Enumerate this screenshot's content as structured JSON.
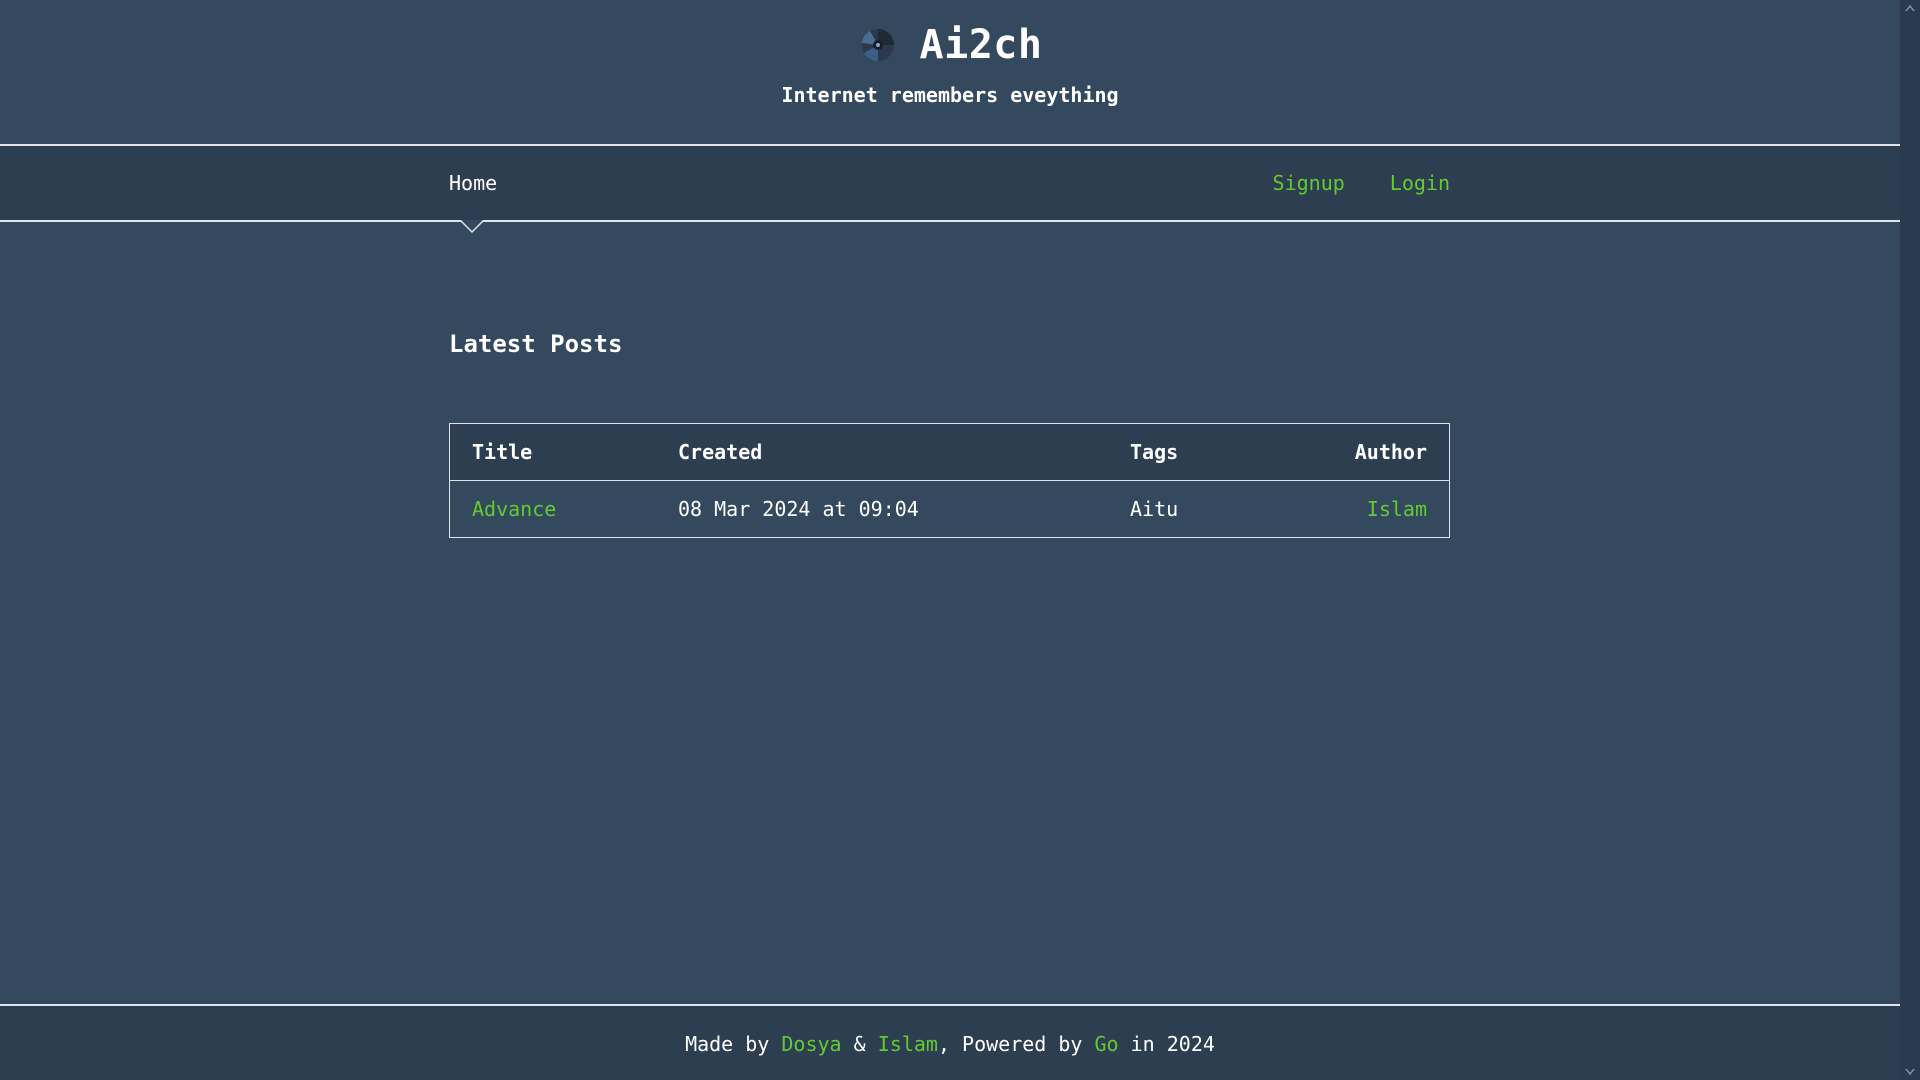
{
  "header": {
    "brand_name": "Ai2ch",
    "tagline": "Internet remembers eveything",
    "logo_icon": "logo-icon"
  },
  "nav": {
    "home_label": "Home",
    "signup_label": "Signup",
    "login_label": "Login"
  },
  "main": {
    "section_title": "Latest Posts",
    "table": {
      "headers": [
        "Title",
        "Created",
        "Tags",
        "Author"
      ],
      "rows": [
        {
          "title": "Advance",
          "created": "08 Mar 2024 at 09:04",
          "tags": "Aitu",
          "author": "Islam"
        }
      ]
    }
  },
  "footer": {
    "made_by_label": "Made by ",
    "author1": "Dosya",
    "amp": " & ",
    "author2": "Islam",
    "powered_by_label": ", Powered by ",
    "tech": "Go",
    "year_label": " in 2024"
  },
  "colors": {
    "background": "#34495e",
    "accent": "#62cb31",
    "bar": "#2d3e50"
  }
}
